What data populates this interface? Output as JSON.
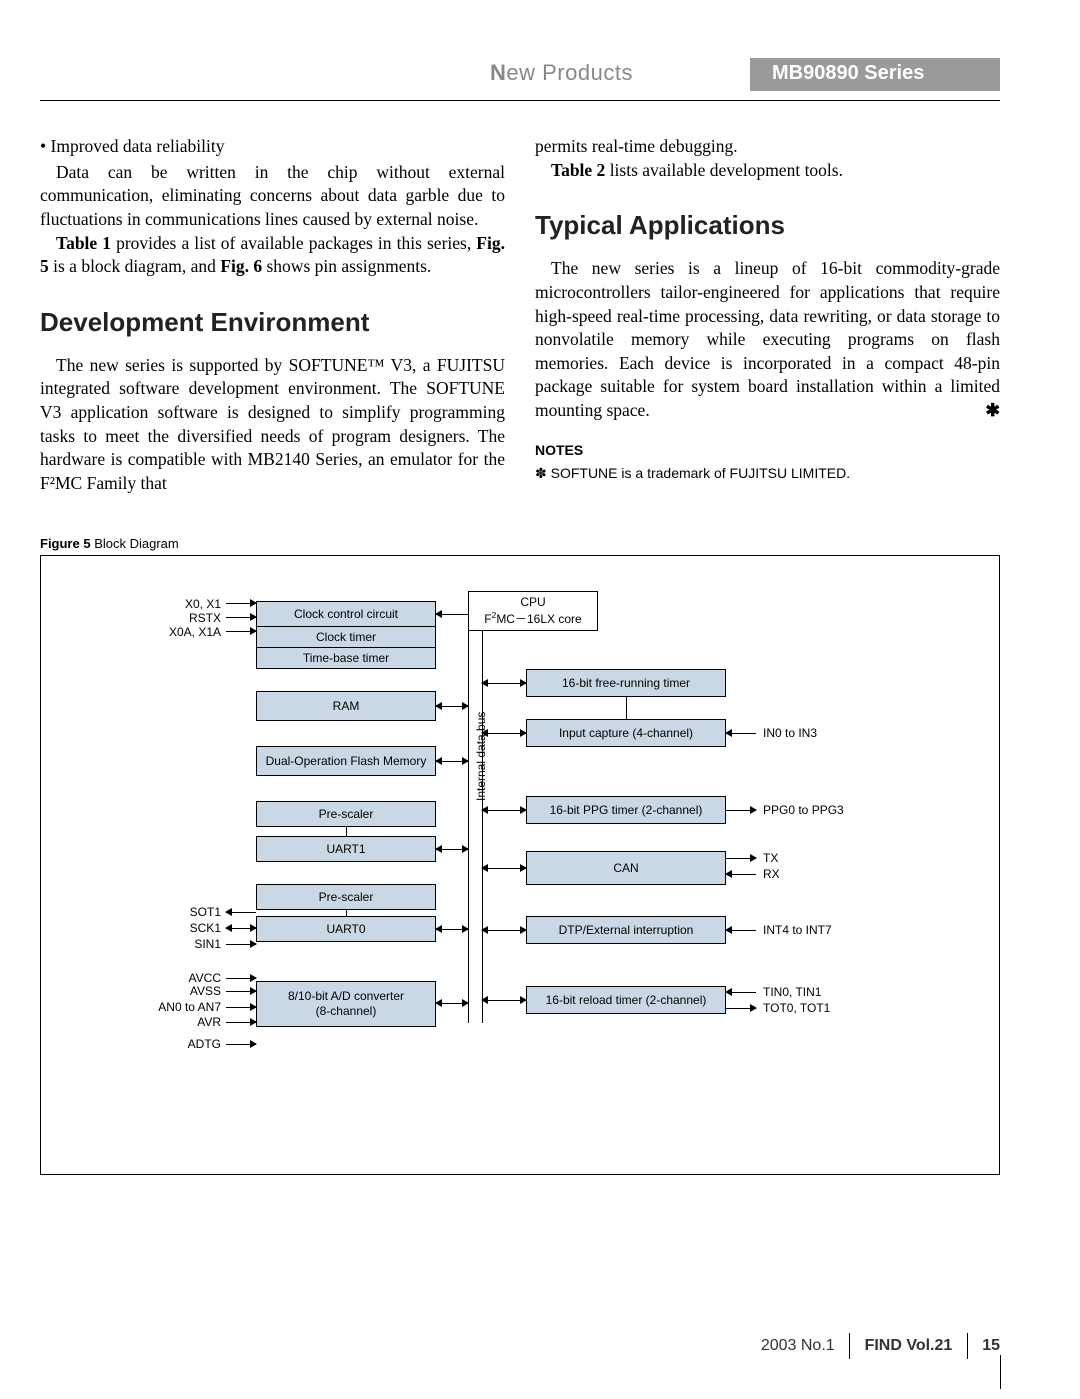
{
  "header": {
    "new_products_html": "New Products",
    "series": "MB90890 Series"
  },
  "left": {
    "bullet": "• Improved data reliability",
    "p1": "Data can be written in the chip without external communication, eliminating concerns about data garble due to fluctuations in communications lines caused by external noise.",
    "p2_a": "Table 1",
    "p2_b": " provides a list of available packages in this series, ",
    "p2_c": "Fig. 5",
    "p2_d": " is a block diagram, and ",
    "p2_e": "Fig. 6",
    "p2_f": " shows pin assignments.",
    "h2": "Development Environment",
    "p3": "The new series is supported by SOFTUNE™ V3, a FUJITSU integrated software development environment. The SOFTUNE V3 application software is designed to simplify programming tasks to meet the diversified needs of program designers. The hardware is compatible with MB2140 Series, an emulator for the F²MC Family that"
  },
  "right": {
    "p1": "permits real-time debugging.",
    "p2_a": "Table 2",
    "p2_b": " lists available development tools.",
    "h2": "Typical Applications",
    "p3": "The new series is a lineup of 16-bit commodity-grade microcontrollers tailor-engineered for applications that require high-speed real-time processing, data rewriting, or data storage to nonvolatile memory while executing programs on flash memories. Each device is incorporated in a compact 48-pin package suitable for system board installation within a limited mounting space.",
    "star": "✱",
    "notes_hd": "NOTES",
    "notes_body": "✽ SOFTUNE is a trademark of FUJITSU LIMITED."
  },
  "figure": {
    "label_bold": "Figure 5",
    "label_rest": "  Block Diagram",
    "pins_left": {
      "x0x1": "X0,  X1",
      "rstx": "RSTX",
      "x0ax1a": "X0A,  X1A",
      "sot1": "SOT1",
      "sck1": "SCK1",
      "sin1": "SIN1",
      "avcc": "AVCC",
      "avss": "AVSS",
      "an0an7": "AN0 to AN7",
      "avr": "AVR",
      "adtg": "ADTG"
    },
    "blocks_left": {
      "clockctrl": "Clock control circuit",
      "clocktimer": "Clock timer",
      "timebase": "Time-base timer",
      "ram": "RAM",
      "flash": "Dual-Operation Flash Memory",
      "prescaler1": "Pre-scaler",
      "uart1": "UART1",
      "prescaler0": "Pre-scaler",
      "uart0": "UART0",
      "adc1": "8/10-bit A/D converter",
      "adc2": "(8-channel)"
    },
    "cpu1": "CPU",
    "cpu2": "F²MC－16LX core",
    "bus": "Internal data bus",
    "blocks_right": {
      "freetimer": "16-bit free-running timer",
      "inputcap": "Input capture (4-channel)",
      "ppg": "16-bit PPG timer (2-channel)",
      "can": "CAN",
      "dtp": "DTP/External interruption",
      "reload": "16-bit reload timer (2-channel)"
    },
    "pins_right": {
      "in0in3": "IN0 to IN3",
      "ppg0ppg3": "PPG0 to PPG3",
      "tx": "TX",
      "rx": "RX",
      "int4int7": "INT4 to INT7",
      "tin": "TIN0,  TIN1",
      "tot": "TOT0,  TOT1"
    }
  },
  "footer": {
    "issue": "2003   No.1",
    "find": "FIND  Vol.21",
    "page": "15"
  }
}
